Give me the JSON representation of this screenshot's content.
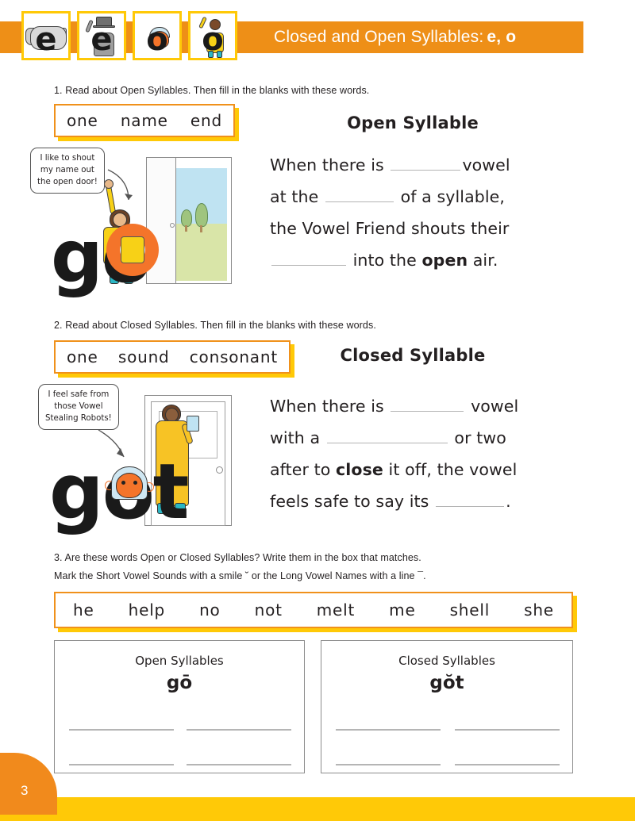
{
  "header": {
    "title_main": "Closed and Open Syllables:",
    "title_bold": "e, o",
    "cards": [
      {
        "letter": "e",
        "character": "elephant-character"
      },
      {
        "letter": "e",
        "character": "man-with-tophat-character"
      },
      {
        "letter": "o",
        "character": "octopus-character"
      },
      {
        "letter": "o",
        "character": "woman-in-yellow-character"
      }
    ]
  },
  "section1": {
    "instruction": "1. Read about Open Syllables. Then fill in the blanks with these words.",
    "word_bank": [
      "one",
      "name",
      "end"
    ],
    "title": "Open Syllable",
    "line1_a": "When there is",
    "line1_b": "vowel",
    "line2_a": "at the",
    "line2_b": "of a syllable,",
    "line3": "the Vowel Friend shouts their",
    "line4_a": "into the",
    "line4_bold": "open",
    "line4_b": "air.",
    "illustration": {
      "bubble_line1": "I like to shout",
      "bubble_line2": "my name out",
      "bubble_line3": "the open door!",
      "big_word": "go",
      "scene": "open-door-outdoors"
    }
  },
  "section2": {
    "instruction": "2. Read about Closed Syllables. Then fill in the blanks with these words.",
    "word_bank": [
      "one",
      "sound",
      "consonant"
    ],
    "title": "Closed Syllable",
    "line1_a": "When there is",
    "line1_b": "vowel",
    "line2_a": "with a",
    "line2_b": "or two",
    "line3_a": "after to",
    "line3_bold": "close",
    "line3_b": "it off, the vowel",
    "line4_a": "feels safe to say its",
    "line4_b": ".",
    "illustration": {
      "bubble_line1": "I feel safe from",
      "bubble_line2": "those Vowel",
      "bubble_line3": "Stealing Robots!",
      "big_word": "got",
      "scene": "closed-door-indoors"
    }
  },
  "section3": {
    "instruction_line1": "3. Are these words Open or Closed Syllables? Write them in the box that matches.",
    "instruction_line2_a": "Mark the Short Vowel Sounds with a smile",
    "smile_mark": "˘",
    "instruction_line2_b": "or the Long Vowel Names with a line",
    "line_mark": "¯",
    "instruction_line2_end": ".",
    "word_bank": [
      "he",
      "help",
      "no",
      "not",
      "melt",
      "me",
      "shell",
      "she"
    ],
    "boxes": [
      {
        "title": "Open Syllables",
        "example": "gō",
        "blank_lines": 4
      },
      {
        "title": "Closed Syllables",
        "example": "gŏt",
        "blank_lines": 4
      }
    ]
  },
  "footer": {
    "page_number": "3"
  },
  "colors": {
    "orange": "#EE8F17",
    "yellow": "#FFC907",
    "border_orange": "#F0911B",
    "text": "#231f20",
    "blank_line": "#b3b3b3"
  }
}
